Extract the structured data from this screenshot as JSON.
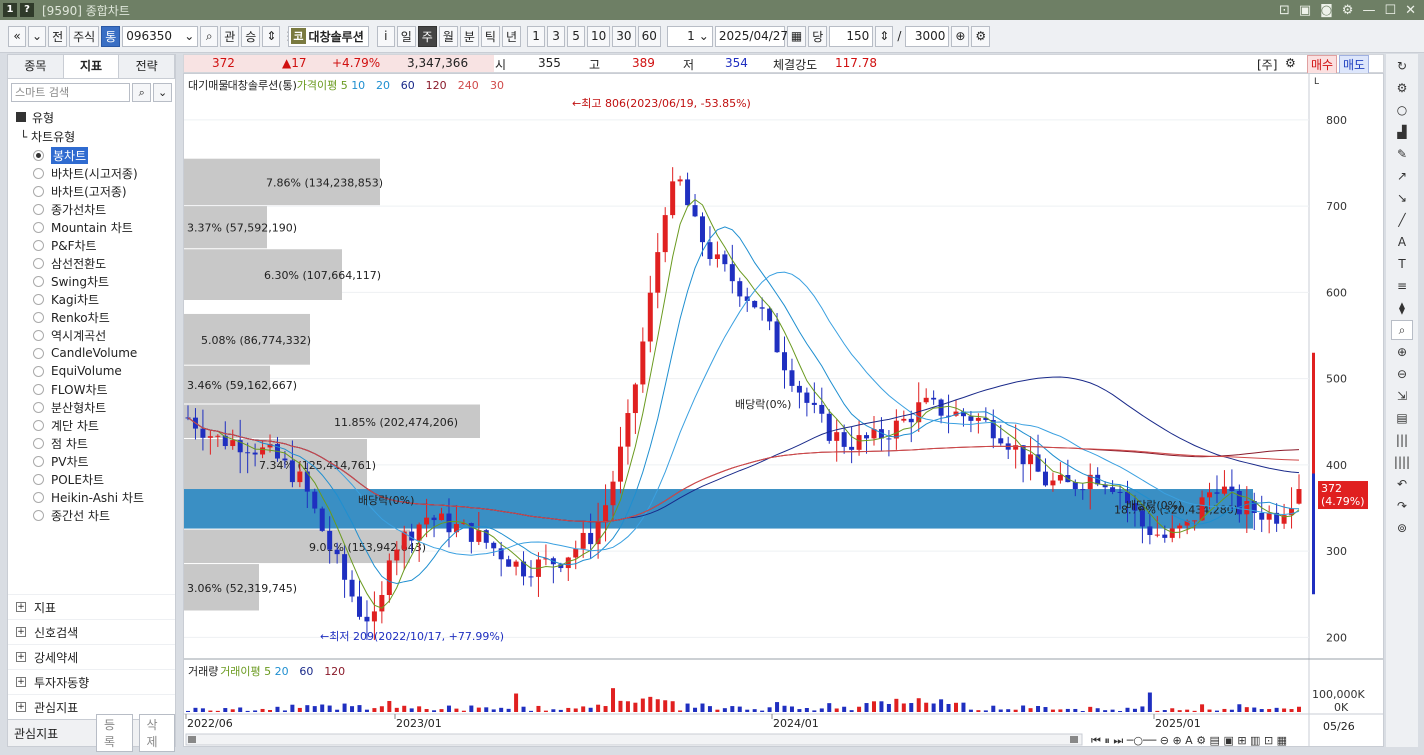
{
  "titlebar": {
    "icon1": "1",
    "icon2": "?",
    "title": "[9590] 종합차트",
    "right_icons": [
      "pin-icon",
      "layout-icon",
      "camera-icon",
      "gear-icon",
      "minimize-icon",
      "maximize-icon",
      "close-icon"
    ]
  },
  "toolbar": {
    "nav_prev": "«",
    "nav_down": "»",
    "jeon": "전",
    "market": "주식",
    "tong": "통",
    "code": "096350",
    "gwan": "관",
    "seung": "승",
    "name_badge": "코",
    "stock_name": "대창솔루션",
    "info": "i",
    "periods": [
      "일",
      "주",
      "월",
      "분",
      "틱",
      "년"
    ],
    "active_period": "주",
    "nums": [
      "1",
      "3",
      "5",
      "10",
      "30",
      "60"
    ],
    "count": "1",
    "date": "2025/04/27",
    "dang": "당",
    "display_count": "150",
    "slash": "/",
    "total": "3000"
  },
  "left": {
    "tabs": [
      "종목",
      "지표",
      "전략"
    ],
    "active_tab": "지표",
    "search_placeholder": "스마트 검색",
    "section": "유형",
    "subsection": "차트유형",
    "chart_types": [
      "봉차트",
      "바차트(시고저종)",
      "바차트(고저종)",
      "종가선차트",
      "Mountain 차트",
      "P&F차트",
      "삼선전환도",
      "Swing차트",
      "Kagi차트",
      "Renko차트",
      "역시계곡선",
      "CandleVolume",
      "EquiVolume",
      "FLOW차트",
      "분산형차트",
      "계단 차트",
      "점 차트",
      "PV차트",
      "POLE차트",
      "Heikin-Ashi 차트",
      "종간선 차트"
    ],
    "selected": "봉차트",
    "groups": [
      "지표",
      "신호검색",
      "강세약세",
      "투자자동향",
      "관심지표"
    ],
    "footer_label": "관심지표",
    "btn_register": "등록",
    "btn_delete": "삭제"
  },
  "quote": {
    "price": "372",
    "change": "▲17",
    "rate": "+4.79%",
    "volume": "3,347,366",
    "open_label": "시",
    "open": "355",
    "high_label": "고",
    "high": "389",
    "low_label": "저",
    "low": "354",
    "strength_label": "체결강도",
    "strength": "117.78",
    "ju": "[주]",
    "buy": "매수",
    "sell": "매도"
  },
  "chart": {
    "legend": [
      {
        "text": "대기매물",
        "color": "#222222"
      },
      {
        "text": "대창솔루션(통)",
        "color": "#222222"
      },
      {
        "text": "가격이평 5",
        "color": "#6a9a1f"
      },
      {
        "text": "10",
        "color": "#1f8fd0"
      },
      {
        "text": "20",
        "color": "#1f8fd0"
      },
      {
        "text": "60",
        "color": "#1a2a8a"
      },
      {
        "text": "120",
        "color": "#8a1a2a"
      },
      {
        "text": "240",
        "color": "#d04a4a"
      },
      {
        "text": "30",
        "color": "#d04a4a"
      }
    ],
    "high_note": "←최고 806(2023/06/19, -53.85%)",
    "low_note": "←최저 209(2022/10/17, +77.99%)",
    "dividend_notes": [
      "배당락(0%)",
      "배당락(0%)",
      "배당락(0%)"
    ],
    "supply_labels": [
      "7.86% (134,238,853)",
      "3.37% (57,592,190)",
      "6.30% (107,664,117)",
      "5.08% (86,774,332)",
      "3.46% (59,162,667)",
      "11.85% (202,474,206)",
      "7.34% (125,414,761)",
      "18.76% (320,434,280)",
      "9.01% (153,942,643)",
      "3.06% (52,319,745)"
    ],
    "y_ticks": [
      "800",
      "700",
      "600",
      "500",
      "400",
      "300",
      "200"
    ],
    "x_ticks": [
      "2022/06",
      "2023/01",
      "2024/01",
      "2025/01"
    ],
    "last_date": "05/26",
    "price_tag": "372",
    "price_tag_rate": "(4.79%)",
    "volume_legend": [
      {
        "text": "거래량",
        "color": "#222222"
      },
      {
        "text": "거래이평 5",
        "color": "#6a9a1f"
      },
      {
        "text": "20",
        "color": "#1f8fd0"
      },
      {
        "text": "60",
        "color": "#1a2a8a"
      },
      {
        "text": "120",
        "color": "#8a1a2a"
      }
    ],
    "vol_ticks": [
      "100,000K",
      "0K"
    ]
  },
  "chart_data": {
    "type": "candlestick",
    "ylim": [
      190,
      830
    ],
    "up_color": "#e02020",
    "down_color": "#1f2fc0",
    "high": 806,
    "low": 209,
    "last": 372,
    "supply_band": [
      325,
      372
    ]
  },
  "right_tools": [
    "refresh-icon",
    "gear-icon",
    "circle-icon",
    "chart-icon",
    "line-tool-icon",
    "ray-icon",
    "arrow-icon",
    "trend-line-icon",
    "auto-icon",
    "text-icon",
    "fibo-icon",
    "candle-icon",
    "zoom-icon",
    "zoom-in-icon",
    "zoom-out-icon",
    "measure-icon",
    "grid-icon",
    "bars-icon",
    "bars2-icon",
    "undo-icon",
    "redo-icon",
    "magnify-icon"
  ]
}
